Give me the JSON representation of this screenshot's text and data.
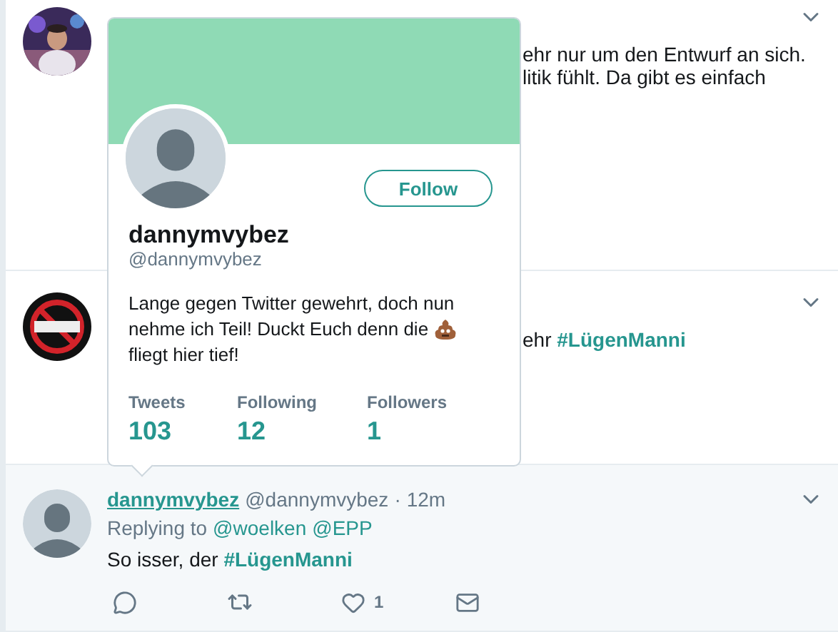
{
  "tweets": [
    {
      "lines": [
        [
          {
            "kind": "text",
            "text": "ehr nur um den Entwurf an sich."
          }
        ],
        [
          {
            "kind": "text",
            "text": "litik fühlt. Da gibt es einfach"
          }
        ]
      ]
    },
    {
      "lines": [
        [
          {
            "kind": "text",
            "text": "ehr "
          },
          {
            "kind": "hashtag",
            "text": "#LügenManni"
          }
        ]
      ]
    },
    {
      "author": "dannymvybez",
      "handle": "@dannymvybez",
      "separator": "·",
      "time": "12m",
      "replying_label": "Replying to",
      "mentions": [
        "@woelken",
        "@EPP"
      ],
      "lines": [
        [
          {
            "kind": "text",
            "text": "So isser, der "
          },
          {
            "kind": "hashtag",
            "text": "#LügenManni"
          }
        ]
      ],
      "actions": [
        {
          "kind": "reply"
        },
        {
          "kind": "retweet"
        },
        {
          "kind": "like",
          "count": "1"
        },
        {
          "kind": "message"
        }
      ]
    }
  ],
  "profile_card": {
    "name": "dannymvybez",
    "handle": "@dannymvybez",
    "follow_label": "Follow",
    "bio_lines": [
      [
        {
          "kind": "text",
          "text": "Lange gegen Twitter gewehrt, doch nun"
        }
      ],
      [
        {
          "kind": "text",
          "text": "nehme ich Teil! Duckt Euch denn die"
        },
        {
          "kind": "emoji"
        }
      ],
      [
        {
          "kind": "text",
          "text": "fliegt hier tief!"
        }
      ]
    ],
    "stats": [
      {
        "label": "Tweets",
        "value": "103"
      },
      {
        "label": "Following",
        "value": "12"
      },
      {
        "label": "Followers",
        "value": "1"
      }
    ]
  }
}
